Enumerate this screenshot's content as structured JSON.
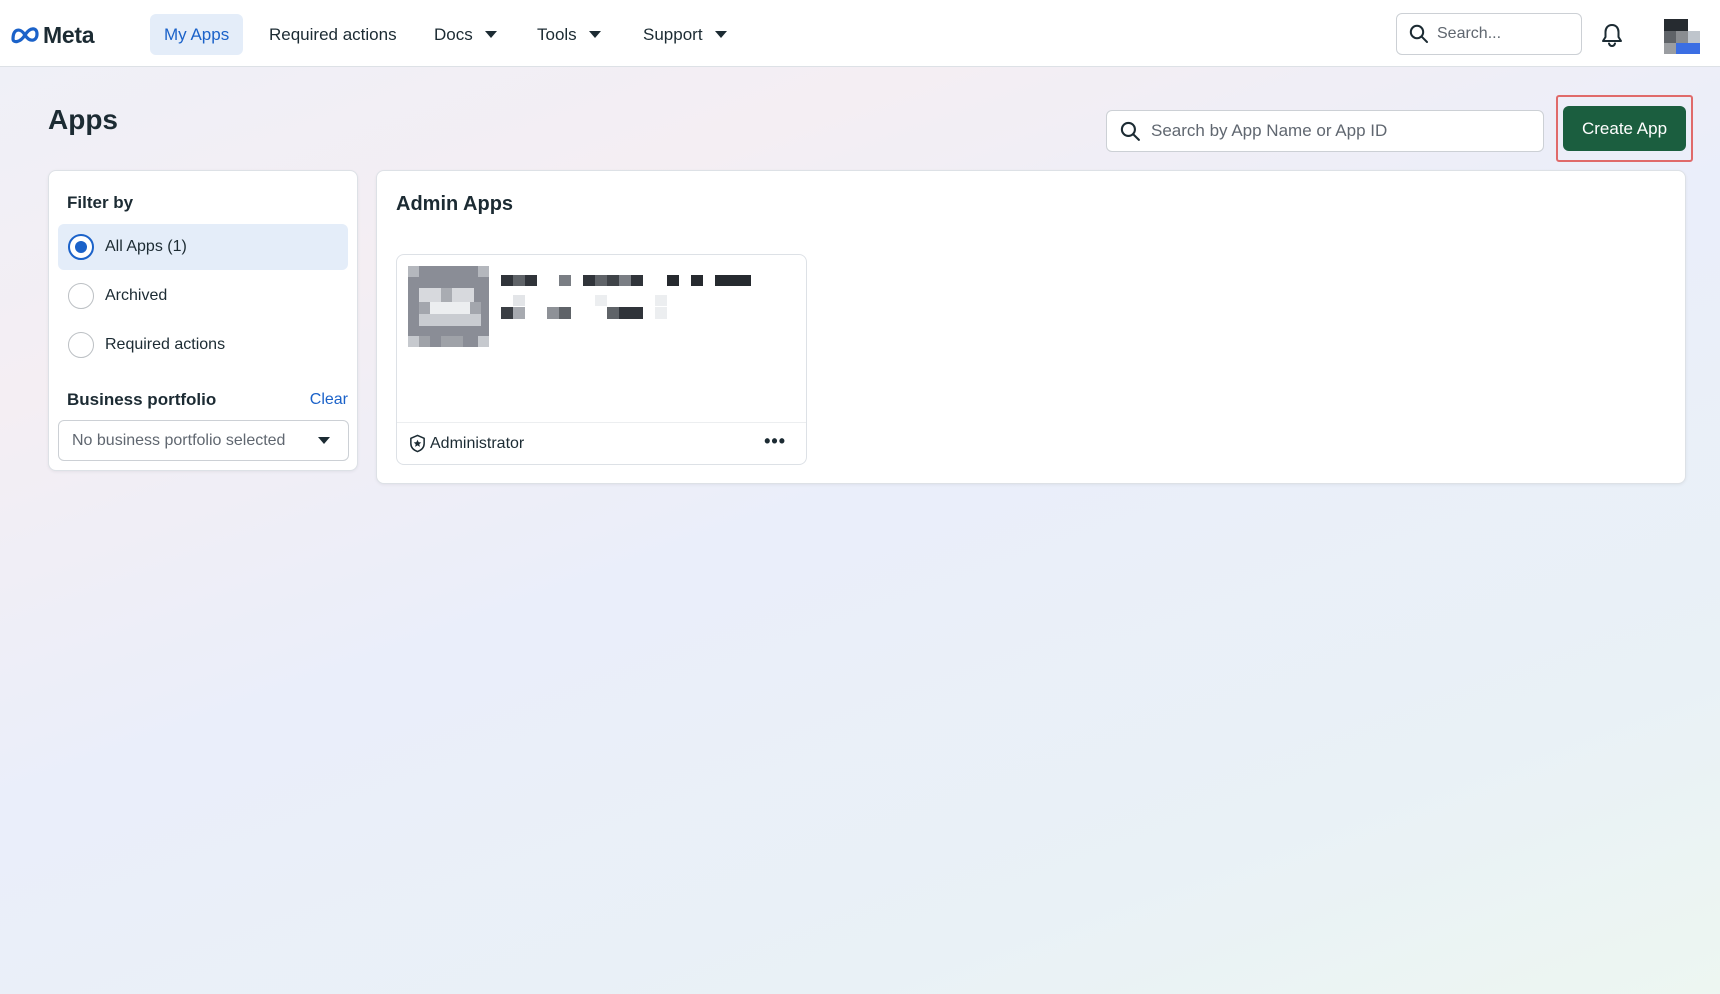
{
  "nav": {
    "logo_text": "Meta",
    "items": [
      {
        "label": "My Apps",
        "active": true
      },
      {
        "label": "Required actions"
      },
      {
        "label": "Docs"
      },
      {
        "label": "Tools"
      },
      {
        "label": "Support"
      }
    ],
    "search_placeholder": "Search..."
  },
  "page": {
    "title": "Apps",
    "search_placeholder": "Search by App Name or App ID",
    "create_button": "Create App"
  },
  "filter": {
    "heading": "Filter by",
    "options": [
      {
        "label": "All Apps (1)",
        "selected": true
      },
      {
        "label": "Archived",
        "selected": false
      },
      {
        "label": "Required actions",
        "selected": false
      }
    ],
    "business_portfolio": {
      "heading": "Business portfolio",
      "clear_label": "Clear",
      "selected_value": "No business portfolio selected"
    }
  },
  "admin_apps": {
    "heading": "Admin Apps",
    "apps": [
      {
        "role": "Administrator",
        "more_label": "•••"
      }
    ]
  },
  "colors": {
    "accent_blue": "#1b62c9",
    "create_button_bg": "#1b5e3f",
    "highlight_border": "#e06a6a"
  },
  "icons": [
    "meta-logo-icon",
    "search-icon",
    "bell-icon",
    "avatar-icon",
    "caret-down-icon",
    "shield-star-icon",
    "more-icon"
  ]
}
